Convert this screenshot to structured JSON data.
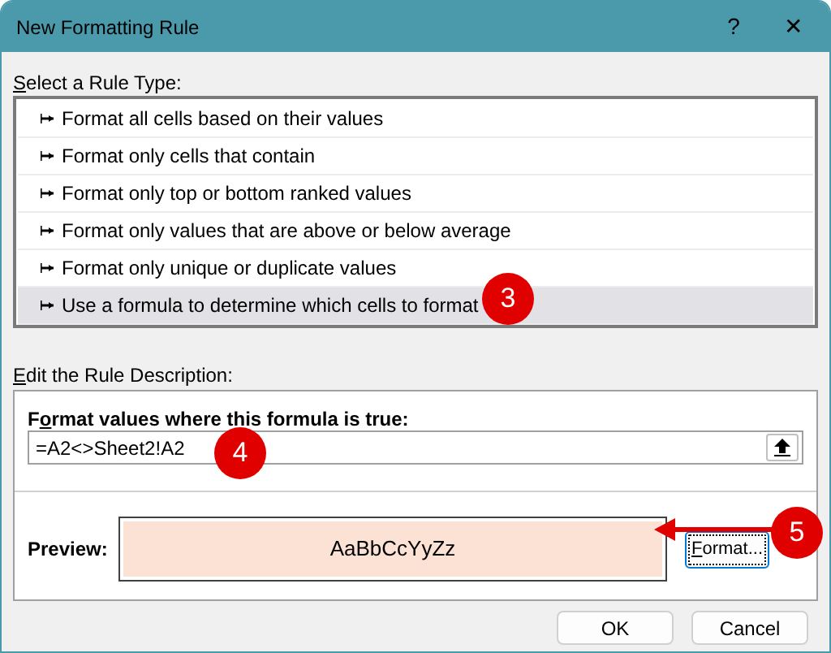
{
  "window": {
    "title": "New Formatting Rule",
    "help": "?",
    "close": "✕"
  },
  "rule_type": {
    "label": "Select a Rule Type:",
    "items": [
      {
        "text": "Format all cells based on their values",
        "selected": false
      },
      {
        "text": "Format only cells that contain",
        "selected": false
      },
      {
        "text": "Format only top or bottom ranked values",
        "selected": false
      },
      {
        "text": "Format only values that are above or below average",
        "selected": false
      },
      {
        "text": "Format only unique or duplicate values",
        "selected": false
      },
      {
        "text": "Use a formula to determine which cells to format",
        "selected": true
      }
    ]
  },
  "description": {
    "label": "Edit the Rule Description:",
    "formula_label": "Format values where this formula is true:",
    "formula_value": "=A2<>Sheet2!A2",
    "preview_label": "Preview:",
    "preview_text": "AaBbCcYyZz",
    "format_button": "Format..."
  },
  "buttons": [
    "OK",
    "Cancel"
  ],
  "callouts": [
    "3",
    "4",
    "5"
  ]
}
